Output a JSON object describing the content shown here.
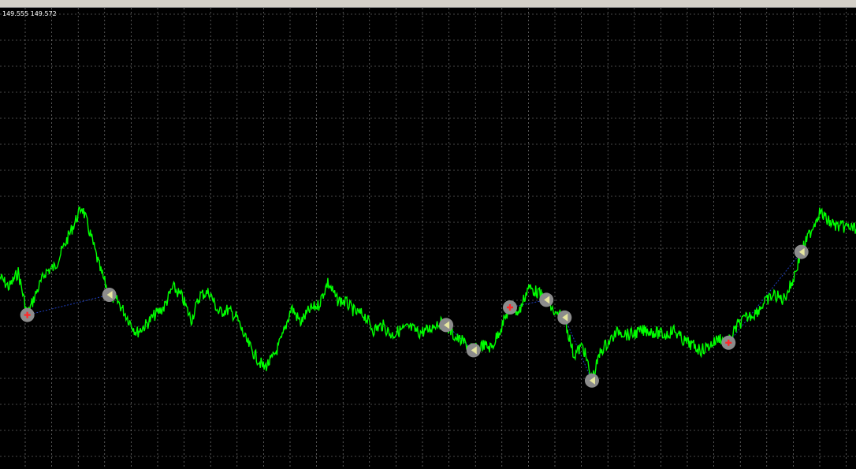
{
  "window": {
    "bid_ask": "149.555 149.572"
  },
  "colors": {
    "background": "#000000",
    "grid": "#c0c0c0",
    "price_line": "#00ff00",
    "trade_link": "#1f3fbf",
    "marker_fill": "#8c8c8c",
    "buy_marker": "#ff2a2a",
    "close_marker": "#e6e6a0"
  },
  "chart_data": {
    "type": "line",
    "grid": true,
    "series": [
      {
        "values": [
          0.62,
          0.58,
          0.64,
          0.47,
          0.56,
          0.64,
          0.66,
          0.74,
          0.82,
          0.9,
          0.78,
          0.65,
          0.55,
          0.52,
          0.46,
          0.4,
          0.43,
          0.47,
          0.5,
          0.58,
          0.54,
          0.45,
          0.55,
          0.56,
          0.48,
          0.49,
          0.46,
          0.37,
          0.31,
          0.26,
          0.3,
          0.38,
          0.5,
          0.44,
          0.49,
          0.51,
          0.6,
          0.53,
          0.52,
          0.48,
          0.47,
          0.41,
          0.43,
          0.39,
          0.41,
          0.42,
          0.4,
          0.41,
          0.44,
          0.43,
          0.38,
          0.36,
          0.33,
          0.35,
          0.34,
          0.42,
          0.5,
          0.48,
          0.58,
          0.56,
          0.53,
          0.47,
          0.46,
          0.31,
          0.35,
          0.21,
          0.33,
          0.37,
          0.41,
          0.39,
          0.4,
          0.41,
          0.4,
          0.39,
          0.41,
          0.37,
          0.35,
          0.33,
          0.35,
          0.38,
          0.36,
          0.43,
          0.46,
          0.48,
          0.52,
          0.55,
          0.53,
          0.6,
          0.72,
          0.8,
          0.88,
          0.84,
          0.82,
          0.82,
          0.81
        ]
      }
    ],
    "trades": [
      {
        "open_index": 3,
        "close_index": 12,
        "open_type": "buy",
        "close_type": "close"
      },
      {
        "open_index": 49,
        "close_index": 52,
        "open_type": "close",
        "close_type": "close"
      },
      {
        "open_index": 56,
        "close_index": 60,
        "open_type": "buy",
        "close_type": "close"
      },
      {
        "open_index": 62,
        "close_index": 65,
        "open_type": "close",
        "close_type": "close"
      },
      {
        "open_index": 80,
        "close_index": 88,
        "open_type": "buy",
        "close_type": "close"
      }
    ]
  }
}
